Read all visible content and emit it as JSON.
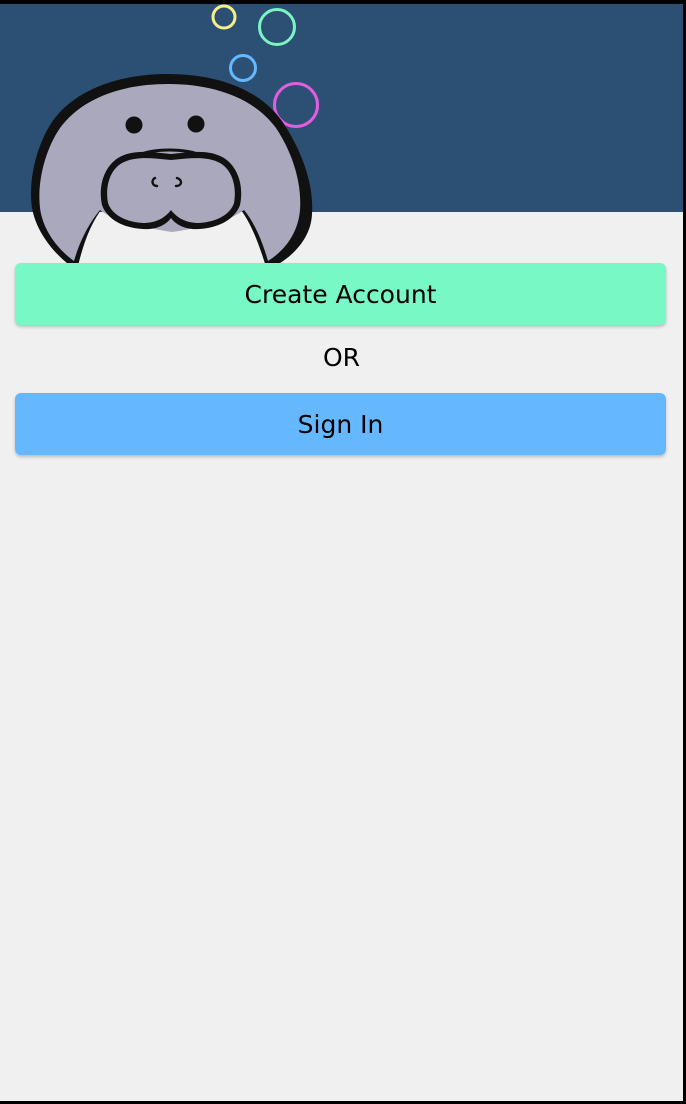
{
  "colors": {
    "header_background": "#2c5073",
    "page_background": "#f0f0f0",
    "create_button": "#78f8c5",
    "signin_button": "#66b8fe",
    "mascot_fill": "#aaa8bd",
    "bubble_yellow": "#f6f08a",
    "bubble_green": "#7cf4c4",
    "bubble_blue": "#66b8fe",
    "bubble_pink": "#e45ce0"
  },
  "header": {
    "mascot_icon": "manatee-icon",
    "bubble_icons": [
      "bubble-yellow-icon",
      "bubble-green-icon",
      "bubble-blue-icon",
      "bubble-pink-icon"
    ]
  },
  "auth": {
    "create_account_label": "Create Account",
    "separator_label": "OR",
    "sign_in_label": "Sign In"
  }
}
